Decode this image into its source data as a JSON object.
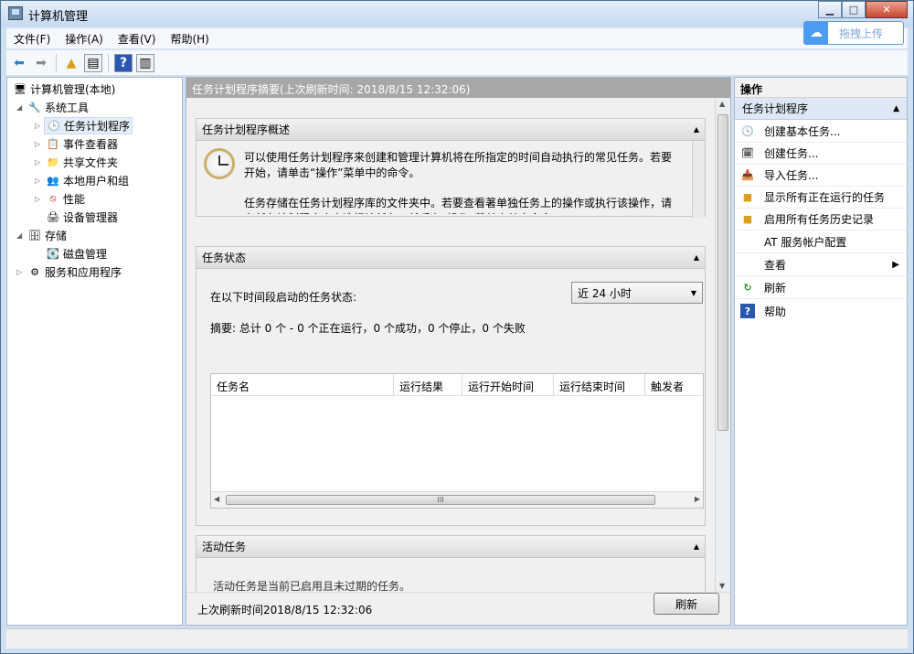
{
  "window": {
    "title": "计算机管理"
  },
  "upload": {
    "label": "拖拽上传"
  },
  "menubar": {
    "items": [
      "文件(F)",
      "操作(A)",
      "查看(V)",
      "帮助(H)"
    ]
  },
  "tree": {
    "root": "计算机管理(本地)",
    "system_tools": "系统工具",
    "task_scheduler": "任务计划程序",
    "event_viewer": "事件查看器",
    "shared_folders": "共享文件夹",
    "local_users": "本地用户和组",
    "performance": "性能",
    "device_manager": "设备管理器",
    "storage": "存储",
    "disk_management": "磁盘管理",
    "services_apps": "服务和应用程序"
  },
  "center": {
    "header": "任务计划程序摘要(上次刷新时间: 2018/8/15 12:32:06)",
    "overview": {
      "title": "任务计划程序概述",
      "para1": "可以使用任务计划程序来创建和管理计算机将在所指定的时间自动执行的常见任务。若要开始，请单击“操作”菜单中的命令。",
      "para2": "任务存储在任务计划程序库的文件夹中。若要查看著单独任务上的操作或执行该操作，请在任务计划程序库中选择该任务，然后在“操作”菜单中单击命令。"
    },
    "status": {
      "title": "任务状态",
      "period_label": "在以下时间段启动的任务状态:",
      "period_value": "近 24 小时",
      "summary": "摘要: 总计 0 个 - 0 个正在运行，0 个成功，0 个停止，0 个失败",
      "columns": [
        "任务名",
        "运行结果",
        "运行开始时间",
        "运行结束时间",
        "触发者"
      ],
      "hscroll_grip": "III"
    },
    "active": {
      "title": "活动任务",
      "text": "活动任务是当前已启用且未过期的任务。"
    },
    "footer": {
      "last_refresh": "上次刷新时间2018/8/15 12:32:06",
      "refresh_button": "刷新"
    }
  },
  "actions": {
    "header": "操作",
    "section": "任务计划程序",
    "items": [
      "创建基本任务...",
      "创建任务...",
      "导入任务...",
      "显示所有正在运行的任务",
      "启用所有任务历史记录",
      "AT 服务帐户配置",
      "查看",
      "刷新",
      "帮助"
    ]
  },
  "colors": {
    "accent": "#4b9bf2",
    "header_gray": "#a7a7a7",
    "selection": "#dde8f4"
  }
}
